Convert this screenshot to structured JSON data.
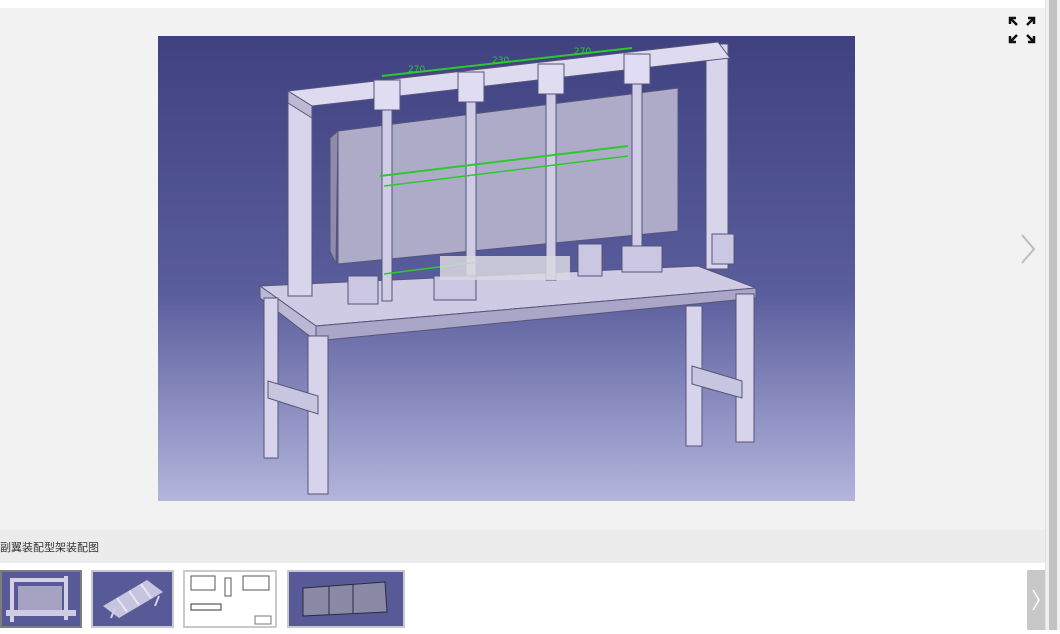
{
  "viewer": {
    "fullscreen_icon": "expand-arrows-icon",
    "next_icon": "chevron-right-icon",
    "main_image_alt": "副翼装配型架装配图",
    "caption": "副翼装配型架装配图",
    "dimension_labels": [
      "270",
      "230",
      "270"
    ],
    "colors": {
      "viewer_bg": "#f2f2f2",
      "cad_bg_top": "#3d3f7a",
      "cad_bg_bottom": "#aeb0d8",
      "frame": "#d4d0e8",
      "dimension": "#2ec82e"
    }
  },
  "thumbnails": [
    {
      "label": "thumbnail-1",
      "active": true
    },
    {
      "label": "thumbnail-2",
      "active": false
    },
    {
      "label": "thumbnail-3",
      "active": false
    },
    {
      "label": "thumbnail-4",
      "active": false
    }
  ]
}
